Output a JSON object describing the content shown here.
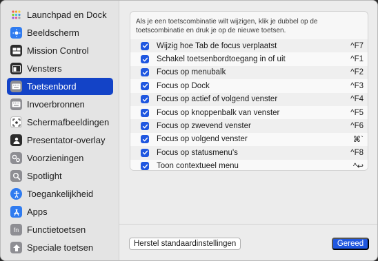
{
  "sidebar": {
    "items": [
      {
        "label": "Launchpad en Dock",
        "icon": "launchpad-icon"
      },
      {
        "label": "Beeldscherm",
        "icon": "display-icon"
      },
      {
        "label": "Mission Control",
        "icon": "mission-control-icon"
      },
      {
        "label": "Vensters",
        "icon": "windows-icon"
      },
      {
        "label": "Toetsenbord",
        "icon": "keyboard-icon",
        "selected": true
      },
      {
        "label": "Invoerbronnen",
        "icon": "input-sources-icon"
      },
      {
        "label": "Schermafbeeldingen",
        "icon": "screenshot-icon"
      },
      {
        "label": "Presentator-overlay",
        "icon": "presenter-icon"
      },
      {
        "label": "Voorzieningen",
        "icon": "services-icon"
      },
      {
        "label": "Spotlight",
        "icon": "spotlight-icon"
      },
      {
        "label": "Toegankelijkheid",
        "icon": "accessibility-icon"
      },
      {
        "label": "Apps",
        "icon": "apps-icon"
      },
      {
        "label": "Functietoetsen",
        "icon": "fn-icon"
      },
      {
        "label": "Speciale toetsen",
        "icon": "modifier-keys-icon"
      }
    ]
  },
  "panel": {
    "note": "Als je een toetscombinatie wilt wijzigen, klik je dubbel op de toetscombinatie en druk je op de nieuwe toetsen.",
    "rows": [
      {
        "label": "Wijzig hoe Tab de focus verplaatst",
        "key": "^F7",
        "checked": true
      },
      {
        "label": "Schakel toetsenbordtoegang in of uit",
        "key": "^F1",
        "checked": true
      },
      {
        "label": "Focus op menubalk",
        "key": "^F2",
        "checked": true
      },
      {
        "label": "Focus op Dock",
        "key": "^F3",
        "checked": true
      },
      {
        "label": "Focus op actief of volgend venster",
        "key": "^F4",
        "checked": true
      },
      {
        "label": "Focus op knoppenbalk van venster",
        "key": "^F5",
        "checked": true
      },
      {
        "label": "Focus op zwevend venster",
        "key": "^F6",
        "checked": true
      },
      {
        "label": "Focus op volgend venster",
        "key": "⌘`",
        "checked": true
      },
      {
        "label": "Focus op statusmenu's",
        "key": "^F8",
        "checked": true
      },
      {
        "label": "Toon contextueel menu",
        "key": "^↩",
        "checked": true
      }
    ]
  },
  "footer": {
    "reset_label": "Herstel standaardinstellingen",
    "done_label": "Gereed"
  },
  "colors": {
    "accent": "#1f57e0",
    "selected_bg": "#1343c7"
  }
}
